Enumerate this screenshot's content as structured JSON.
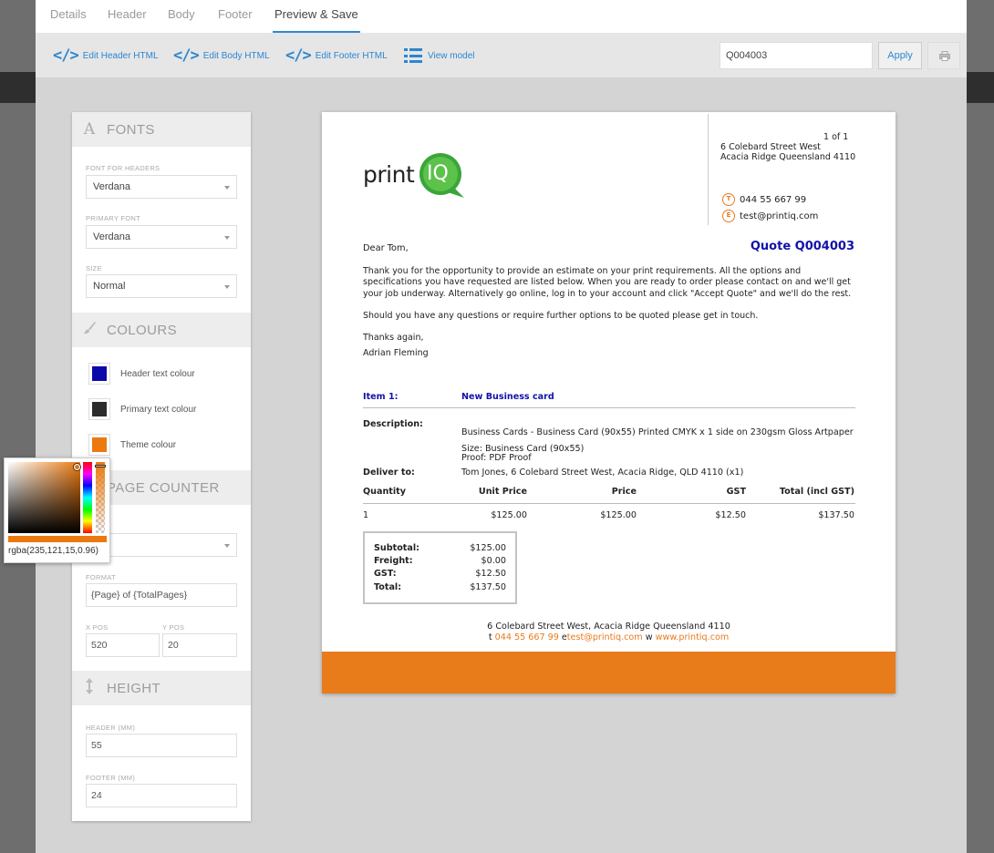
{
  "tabs": [
    {
      "label": "Details"
    },
    {
      "label": "Header"
    },
    {
      "label": "Body"
    },
    {
      "label": "Footer"
    },
    {
      "label": "Preview & Save",
      "active": true
    }
  ],
  "toolbar": {
    "edit_header": "Edit Header HTML",
    "edit_body": "Edit Body HTML",
    "edit_footer": "Edit Footer HTML",
    "view_model": "View model",
    "quote_value": "Q004003",
    "apply": "Apply",
    "print_icon": "printer-icon"
  },
  "sidebar": {
    "fonts": {
      "title": "FONTS",
      "icon": "font-icon",
      "header_font_label": "FONT FOR HEADERS",
      "header_font": "Verdana",
      "primary_font_label": "PRIMARY FONT",
      "primary_font": "Verdana",
      "size_label": "SIZE",
      "size": "Normal"
    },
    "colours": {
      "title": "COLOURS",
      "icon": "brush-icon",
      "items": [
        {
          "label": "Header text colour",
          "color": "#0a0aaa"
        },
        {
          "label": "Primary text colour",
          "color": "#2c2c2c"
        },
        {
          "label": "Theme colour",
          "color": "#eb790f"
        }
      ]
    },
    "page_counter": {
      "title": "PAGE COUNTER",
      "position_value": "om",
      "format_label": "FORMAT",
      "format": "{Page} of {TotalPages}",
      "xpos_label": "X POS",
      "xpos": "520",
      "ypos_label": "Y POS",
      "ypos": "20"
    },
    "height": {
      "title": "HEIGHT",
      "icon": "resize-vertical-icon",
      "header_label": "HEADER (MM)",
      "header": "55",
      "footer_label": "FOOTER (MM)",
      "footer": "24"
    }
  },
  "color_picker": {
    "value": "rgba(235,121,15,0.96)",
    "color": "#eb790f"
  },
  "document": {
    "logo_text": "print",
    "logo_badge": "IQ",
    "page_count": "1 of 1",
    "address_line1": "6 Colebard Street West",
    "address_line2": "Acacia Ridge Queensland 4110",
    "phone_icon": "T",
    "phone": "044 55 667 99",
    "email_icon": "E",
    "email": "test@printiq.com",
    "greeting": "Dear Tom,",
    "quote_title": "Quote Q004003",
    "para1": "Thank you for the opportunity to provide an estimate on your print requirements. All the options and specifications you have requested are listed below. When you are ready to order please contact on and we'll get your job underway. Alternatively go online, log in to your account and click \"Accept Quote\" and we'll do the rest.",
    "para2": "Should you have any questions or require further options to be quoted please get in touch.",
    "thanks": "Thanks again,",
    "signer": "Adrian Fleming",
    "item_label": "Item 1:",
    "item_name": "New Business card",
    "description_label": "Description:",
    "description": "Business Cards - Business Card (90x55) Printed CMYK x 1 side on 230gsm Gloss Artpaper",
    "size_line": "Size: Business Card (90x55)",
    "proof_line": "Proof: PDF Proof",
    "deliver_label": "Deliver to:",
    "deliver_to": "Tom Jones, 6 Colebard Street West, Acacia Ridge, QLD 4110 (x1)",
    "columns": [
      "Quantity",
      "Unit Price",
      "Price",
      "GST",
      "Total (incl GST)"
    ],
    "row": [
      "1",
      "$125.00",
      "$125.00",
      "$12.50",
      "$137.50"
    ],
    "totals": [
      {
        "label": "Subtotal:",
        "value": "$125.00"
      },
      {
        "label": "Freight:",
        "value": "$0.00"
      },
      {
        "label": "GST:",
        "value": "$12.50"
      },
      {
        "label": "Total:",
        "value": "$137.50"
      }
    ],
    "footer_address": "6 Colebard Street West, Acacia Ridge Queensland 4110",
    "footer_t": "t",
    "footer_phone": "044 55 667 99",
    "footer_e": "e",
    "footer_email": "test@printiq.com",
    "footer_w": "w",
    "footer_web": "www.printiq.com",
    "theme_color": "#e87c1a",
    "header_color": "#1111aa"
  }
}
